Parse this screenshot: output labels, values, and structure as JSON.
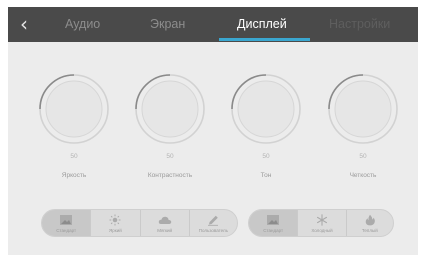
{
  "topbar": {
    "tabs": [
      {
        "label": "Аудио"
      },
      {
        "label": "Экран"
      },
      {
        "label": "Дисплей"
      },
      {
        "label": "Настройки"
      }
    ],
    "active_tab": "Дисплей"
  },
  "dials": [
    {
      "label": "Яркость",
      "value": "50"
    },
    {
      "label": "Контрастность",
      "value": "50"
    },
    {
      "label": "Тон",
      "value": "50"
    },
    {
      "label": "Четкость",
      "value": "50"
    }
  ],
  "picture_mode": {
    "options": [
      {
        "label": "Стандарт",
        "icon": "picture-icon",
        "selected": true
      },
      {
        "label": "Яркий",
        "icon": "sun-icon"
      },
      {
        "label": "Мягкий",
        "icon": "cloud-icon"
      },
      {
        "label": "Пользователь",
        "icon": "pencil-icon"
      }
    ]
  },
  "color_temp": {
    "options": [
      {
        "label": "Стандарт",
        "icon": "picture-icon",
        "selected": true
      },
      {
        "label": "Холодный",
        "icon": "snowflake-icon"
      },
      {
        "label": "Теплый",
        "icon": "flame-icon"
      }
    ]
  },
  "colors": {
    "accent": "#3aa7d0",
    "topbar": "#4a4a4a",
    "panel": "#ececec"
  }
}
